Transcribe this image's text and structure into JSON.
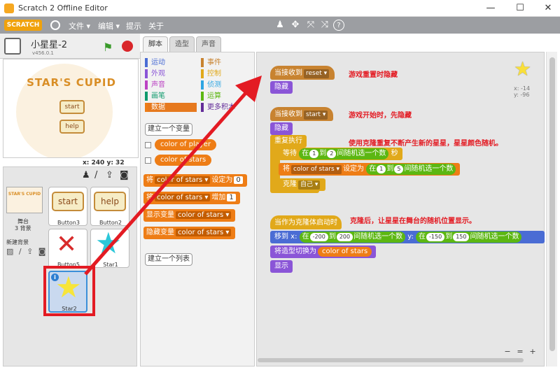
{
  "window": {
    "title": "Scratch 2 Offline Editor",
    "minimize": "—",
    "maximize": "☐",
    "close": "✕"
  },
  "menubar": {
    "logo": "SCRATCH",
    "items": [
      "文件 ▾",
      "编辑 ▾",
      "提示",
      "关于"
    ],
    "tools": [
      "♟",
      "✥",
      "⤧",
      "⤨",
      "?"
    ]
  },
  "stage_header": {
    "project_name": "小星星-2",
    "version": "v456.0.1"
  },
  "stage": {
    "title": "STAR'S CUPID",
    "start_button": "start",
    "help_button": "help"
  },
  "coords": "x: 240  y: 32",
  "sprites_panel": {
    "tools": [
      "♟",
      "/",
      "⇪",
      "◙"
    ],
    "stage_thumb_text": "STAR'S CUPID",
    "stage_label": "舞台",
    "stage_bg_count": "3 背景",
    "new_bg_label": "新建背景",
    "new_bg_icons": "▨ / ⇪ ◙",
    "sprites": [
      {
        "name": "Button3",
        "thumb": "start"
      },
      {
        "name": "Button2",
        "thumb": "help"
      },
      {
        "name": "Button5",
        "thumb": "✕"
      },
      {
        "name": "Star1",
        "thumb": "★"
      },
      {
        "name": "Star2",
        "thumb": "★",
        "info": "i"
      }
    ]
  },
  "tabs": [
    "脚本",
    "造型",
    "声音"
  ],
  "palette": {
    "categories": [
      {
        "label": "运动",
        "color": "#4a6cd4"
      },
      {
        "label": "事件",
        "color": "#c88330"
      },
      {
        "label": "外观",
        "color": "#8a55d7"
      },
      {
        "label": "控制",
        "color": "#e1a91a"
      },
      {
        "label": "声音",
        "color": "#bb42c3"
      },
      {
        "label": "侦测",
        "color": "#2ca5e2"
      },
      {
        "label": "画笔",
        "color": "#0e9a6c"
      },
      {
        "label": "运算",
        "color": "#5cb712"
      },
      {
        "label": "数据",
        "color": "#ee7d16"
      },
      {
        "label": "更多积木",
        "color": "#632d99"
      }
    ],
    "make_var": "建立一个变量",
    "var1": "color of player",
    "var2": "color of stars",
    "set_block": {
      "pre": "将",
      "dd": "color of stars ▾",
      "mid": "设定为",
      "val": "0"
    },
    "change_block": {
      "pre": "将",
      "dd": "color of stars ▾",
      "mid": "增加",
      "val": "1"
    },
    "show_block": {
      "pre": "显示变量",
      "dd": "color of stars ▾"
    },
    "hide_block": {
      "pre": "隐藏变量",
      "dd": "color of stars ▾"
    },
    "make_list": "建立一个列表"
  },
  "scripts": {
    "s1_hat": "当接收到",
    "s1_msg": "reset ▾",
    "s1_hide": "隐藏",
    "s2_hat": "当接收到",
    "s2_msg": "start ▾",
    "s2_hide": "隐藏",
    "repeat": "重复执行",
    "wait": "等待",
    "wait_in": "在",
    "n1": "1",
    "to": "到",
    "n2": "2",
    "rand": "间随机选一个数",
    "sec": "秒",
    "set": "将",
    "set_var": "color of stars ▾",
    "set_to": "设定为",
    "set_in": "在",
    "n3": "1",
    "to2": "到",
    "n4": "5",
    "rand2": "间随机选一个数",
    "clone": "克隆",
    "clone_target": "自己 ▾",
    "s3_hat": "当作为克隆体启动时",
    "goto": "移到 x:",
    "gx_in": "在",
    "gx1": "-200",
    "gx_to": "到",
    "gx2": "200",
    "gx_rand": "间随机选一个数",
    "gy": "y:",
    "gy_in": "在",
    "gy1": "-150",
    "gy_to": "到",
    "gy2": "150",
    "gy_rand": "间随机选一个数",
    "switch": "将造型切换为",
    "switch_val": "color of stars",
    "show": "显示"
  },
  "annotations": [
    "游戏重置时隐藏",
    "游戏开始时，先隐藏",
    "使用克隆重复不断产生新的星星，星星颜色随机。",
    "克隆后，让星星在舞台的随机位置显示。"
  ],
  "sprite_info": {
    "x": "x: -14",
    "y": "y: -96"
  },
  "zoom": [
    "−",
    "=",
    "+"
  ],
  "colors": {
    "annotation": "#e31b23",
    "menubar": "#9c9ea2"
  }
}
